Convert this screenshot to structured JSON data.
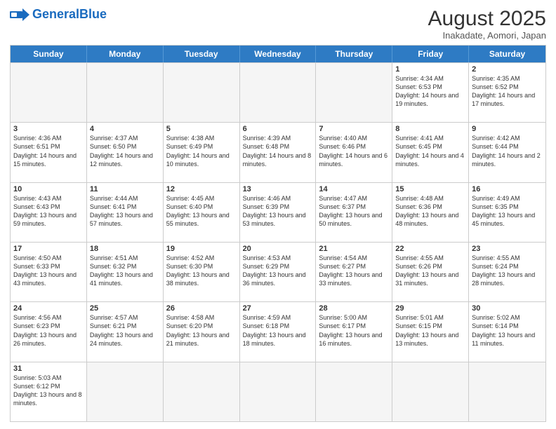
{
  "header": {
    "logo_general": "General",
    "logo_blue": "Blue",
    "title": "August 2025",
    "subtitle": "Inakadate, Aomori, Japan"
  },
  "days": [
    "Sunday",
    "Monday",
    "Tuesday",
    "Wednesday",
    "Thursday",
    "Friday",
    "Saturday"
  ],
  "weeks": [
    [
      {
        "day": "",
        "info": "",
        "empty": true
      },
      {
        "day": "",
        "info": "",
        "empty": true
      },
      {
        "day": "",
        "info": "",
        "empty": true
      },
      {
        "day": "",
        "info": "",
        "empty": true
      },
      {
        "day": "",
        "info": "",
        "empty": true
      },
      {
        "day": "1",
        "info": "Sunrise: 4:34 AM\nSunset: 6:53 PM\nDaylight: 14 hours and 19 minutes."
      },
      {
        "day": "2",
        "info": "Sunrise: 4:35 AM\nSunset: 6:52 PM\nDaylight: 14 hours and 17 minutes."
      }
    ],
    [
      {
        "day": "3",
        "info": "Sunrise: 4:36 AM\nSunset: 6:51 PM\nDaylight: 14 hours and 15 minutes."
      },
      {
        "day": "4",
        "info": "Sunrise: 4:37 AM\nSunset: 6:50 PM\nDaylight: 14 hours and 12 minutes."
      },
      {
        "day": "5",
        "info": "Sunrise: 4:38 AM\nSunset: 6:49 PM\nDaylight: 14 hours and 10 minutes."
      },
      {
        "day": "6",
        "info": "Sunrise: 4:39 AM\nSunset: 6:48 PM\nDaylight: 14 hours and 8 minutes."
      },
      {
        "day": "7",
        "info": "Sunrise: 4:40 AM\nSunset: 6:46 PM\nDaylight: 14 hours and 6 minutes."
      },
      {
        "day": "8",
        "info": "Sunrise: 4:41 AM\nSunset: 6:45 PM\nDaylight: 14 hours and 4 minutes."
      },
      {
        "day": "9",
        "info": "Sunrise: 4:42 AM\nSunset: 6:44 PM\nDaylight: 14 hours and 2 minutes."
      }
    ],
    [
      {
        "day": "10",
        "info": "Sunrise: 4:43 AM\nSunset: 6:43 PM\nDaylight: 13 hours and 59 minutes."
      },
      {
        "day": "11",
        "info": "Sunrise: 4:44 AM\nSunset: 6:41 PM\nDaylight: 13 hours and 57 minutes."
      },
      {
        "day": "12",
        "info": "Sunrise: 4:45 AM\nSunset: 6:40 PM\nDaylight: 13 hours and 55 minutes."
      },
      {
        "day": "13",
        "info": "Sunrise: 4:46 AM\nSunset: 6:39 PM\nDaylight: 13 hours and 53 minutes."
      },
      {
        "day": "14",
        "info": "Sunrise: 4:47 AM\nSunset: 6:37 PM\nDaylight: 13 hours and 50 minutes."
      },
      {
        "day": "15",
        "info": "Sunrise: 4:48 AM\nSunset: 6:36 PM\nDaylight: 13 hours and 48 minutes."
      },
      {
        "day": "16",
        "info": "Sunrise: 4:49 AM\nSunset: 6:35 PM\nDaylight: 13 hours and 45 minutes."
      }
    ],
    [
      {
        "day": "17",
        "info": "Sunrise: 4:50 AM\nSunset: 6:33 PM\nDaylight: 13 hours and 43 minutes."
      },
      {
        "day": "18",
        "info": "Sunrise: 4:51 AM\nSunset: 6:32 PM\nDaylight: 13 hours and 41 minutes."
      },
      {
        "day": "19",
        "info": "Sunrise: 4:52 AM\nSunset: 6:30 PM\nDaylight: 13 hours and 38 minutes."
      },
      {
        "day": "20",
        "info": "Sunrise: 4:53 AM\nSunset: 6:29 PM\nDaylight: 13 hours and 36 minutes."
      },
      {
        "day": "21",
        "info": "Sunrise: 4:54 AM\nSunset: 6:27 PM\nDaylight: 13 hours and 33 minutes."
      },
      {
        "day": "22",
        "info": "Sunrise: 4:55 AM\nSunset: 6:26 PM\nDaylight: 13 hours and 31 minutes."
      },
      {
        "day": "23",
        "info": "Sunrise: 4:55 AM\nSunset: 6:24 PM\nDaylight: 13 hours and 28 minutes."
      }
    ],
    [
      {
        "day": "24",
        "info": "Sunrise: 4:56 AM\nSunset: 6:23 PM\nDaylight: 13 hours and 26 minutes."
      },
      {
        "day": "25",
        "info": "Sunrise: 4:57 AM\nSunset: 6:21 PM\nDaylight: 13 hours and 24 minutes."
      },
      {
        "day": "26",
        "info": "Sunrise: 4:58 AM\nSunset: 6:20 PM\nDaylight: 13 hours and 21 minutes."
      },
      {
        "day": "27",
        "info": "Sunrise: 4:59 AM\nSunset: 6:18 PM\nDaylight: 13 hours and 18 minutes."
      },
      {
        "day": "28",
        "info": "Sunrise: 5:00 AM\nSunset: 6:17 PM\nDaylight: 13 hours and 16 minutes."
      },
      {
        "day": "29",
        "info": "Sunrise: 5:01 AM\nSunset: 6:15 PM\nDaylight: 13 hours and 13 minutes."
      },
      {
        "day": "30",
        "info": "Sunrise: 5:02 AM\nSunset: 6:14 PM\nDaylight: 13 hours and 11 minutes."
      }
    ],
    [
      {
        "day": "31",
        "info": "Sunrise: 5:03 AM\nSunset: 6:12 PM\nDaylight: 13 hours and 8 minutes."
      },
      {
        "day": "",
        "info": "",
        "empty": true
      },
      {
        "day": "",
        "info": "",
        "empty": true
      },
      {
        "day": "",
        "info": "",
        "empty": true
      },
      {
        "day": "",
        "info": "",
        "empty": true
      },
      {
        "day": "",
        "info": "",
        "empty": true
      },
      {
        "day": "",
        "info": "",
        "empty": true
      }
    ]
  ]
}
